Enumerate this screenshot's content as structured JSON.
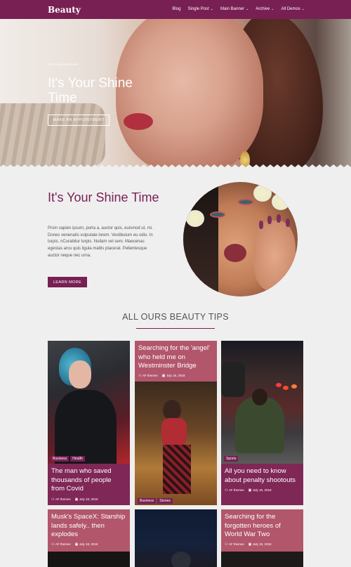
{
  "nav": {
    "brand": "Beauty",
    "items": [
      {
        "label": "Blog",
        "has_menu": false
      },
      {
        "label": "Single Post",
        "has_menu": true
      },
      {
        "label": "Main Banner",
        "has_menu": true
      },
      {
        "label": "Archive",
        "has_menu": true
      },
      {
        "label": "All Demos",
        "has_menu": true
      }
    ]
  },
  "hero": {
    "tagline": "Get a glossy look",
    "title": "It's Your Shine Time",
    "button": "MAKE AN APPOINTMENT"
  },
  "about": {
    "title": "It's Your Shine Time",
    "body": "Proin sapien ipsum, porta a, auctor quis, euismod ut, mi. Donec venenatis vulputate lorem. Vestibulum eu odio. In turpis. nCurabitur turpis. Nullam vel sem. Maecenas egestas arcu quis ligula mattis placerat. Pellentesque auctor neque nec urna.",
    "button": "LEARN MORE"
  },
  "tips": {
    "title": "ALL OURS BEAUTY TIPS",
    "posts": [
      {
        "title": "The man who saved thousands of people from Covid",
        "author": "AF themes",
        "date": "July 18, 2018",
        "categories": [
          "Business",
          "Health"
        ]
      },
      {
        "title": "Searching for the 'angel' who held me on Westminster Bridge",
        "author": "AF themes",
        "date": "July 18, 2018",
        "categories": [
          "Business",
          "Stories"
        ]
      },
      {
        "title": "All you need to know about penalty shootouts",
        "author": "AF themes",
        "date": "July 18, 2018",
        "categories": [
          "Sports"
        ]
      },
      {
        "title": "Musk's SpaceX: Starship lands safely.. then explodes",
        "author": "AF themes",
        "date": "July 18, 2018",
        "categories": []
      },
      {
        "title": "Searching for the forgotten heroes of World War Two",
        "author": "AF themes",
        "date": "July 18, 2018",
        "categories": []
      }
    ]
  },
  "colors": {
    "brand": "#781f54",
    "card_caption": "#7f2756",
    "card_caption_light": "#b2566c"
  },
  "icons": {
    "author": "user-icon",
    "date": "calendar-icon",
    "menu": "chevron-down-icon"
  }
}
